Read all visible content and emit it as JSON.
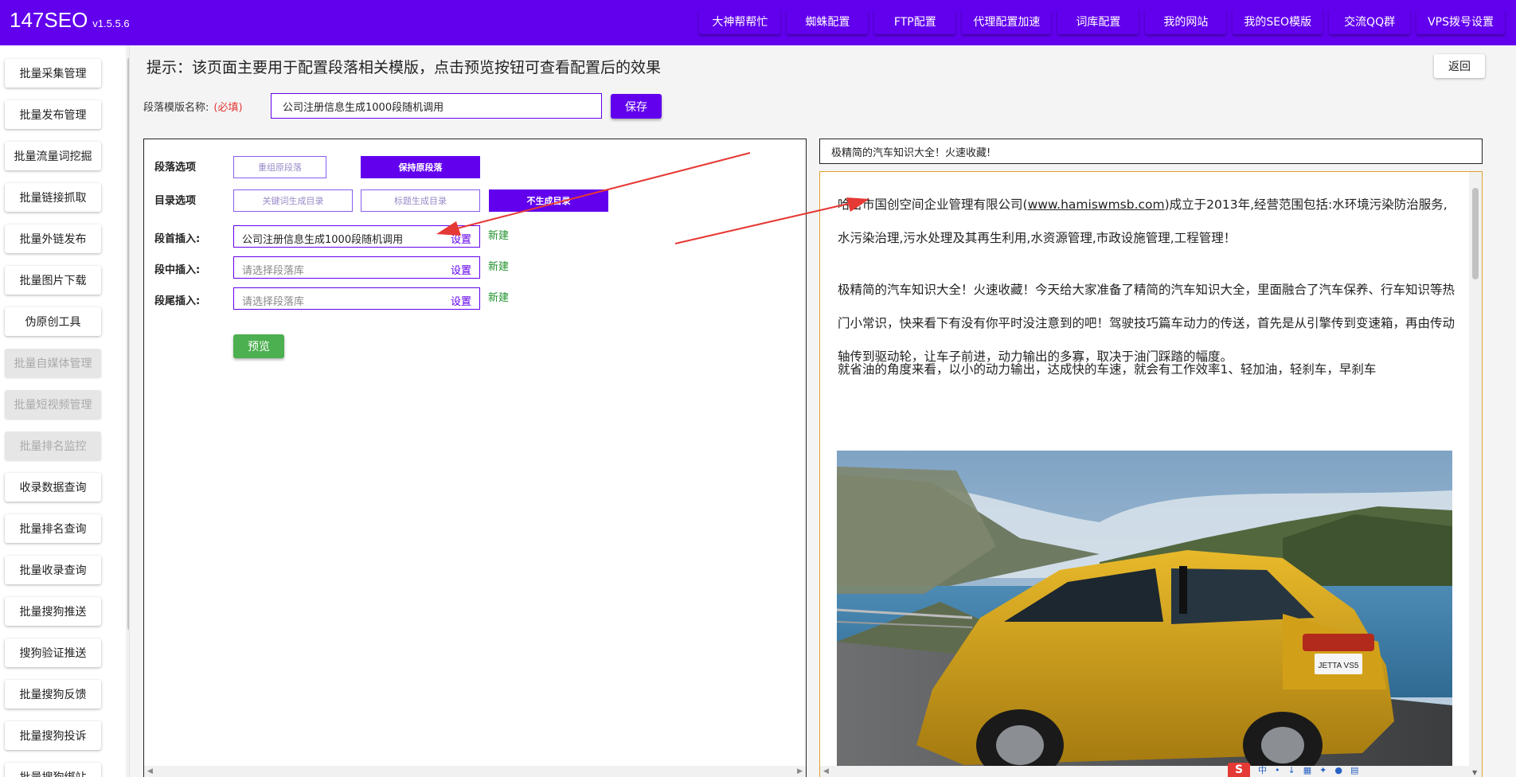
{
  "header": {
    "brand": "147SEO",
    "version": "v1.5.5.6",
    "nav": [
      "大神帮帮忙",
      "蜘蛛配置",
      "FTP配置",
      "代理配置加速",
      "词库配置",
      "我的网站",
      "我的SEO模版",
      "交流QQ群",
      "VPS拨号设置"
    ]
  },
  "sidebar": {
    "items": [
      {
        "label": "批量采集管理",
        "enabled": true
      },
      {
        "label": "批量发布管理",
        "enabled": true
      },
      {
        "label": "批量流量词挖掘",
        "enabled": true
      },
      {
        "label": "批量链接抓取",
        "enabled": true
      },
      {
        "label": "批量外链发布",
        "enabled": true
      },
      {
        "label": "批量图片下载",
        "enabled": true
      },
      {
        "label": "伪原创工具",
        "enabled": true
      },
      {
        "label": "批量自媒体管理",
        "enabled": false
      },
      {
        "label": "批量短视频管理",
        "enabled": false
      },
      {
        "label": "批量排名监控",
        "enabled": false
      },
      {
        "label": "收录数据查询",
        "enabled": true
      },
      {
        "label": "批量排名查询",
        "enabled": true
      },
      {
        "label": "批量收录查询",
        "enabled": true
      },
      {
        "label": "批量搜狗推送",
        "enabled": true
      },
      {
        "label": "搜狗验证推送",
        "enabled": true
      },
      {
        "label": "批量搜狗反馈",
        "enabled": true
      },
      {
        "label": "批量搜狗投诉",
        "enabled": true
      },
      {
        "label": "批量搜狗绑站",
        "enabled": true
      }
    ]
  },
  "main": {
    "hint": "提示：该页面主要用于配置段落相关模版，点击预览按钮可查看配置后的效果",
    "back_label": "返回",
    "template_name_label": "段落模版名称:",
    "required_mark": "(必填)",
    "template_name_value": "公司注册信息生成1000段随机调用",
    "save_label": "保存"
  },
  "config": {
    "paragraph_options_label": "段落选项",
    "paragraph_options": [
      "重组原段落",
      "保持原段落"
    ],
    "paragraph_selected": 1,
    "toc_options_label": "目录选项",
    "toc_options": [
      "关键词生成目录",
      "标题生成目录",
      "不生成目录"
    ],
    "toc_selected": 2,
    "inserts": [
      {
        "label": "段首插入:",
        "value": "公司注册信息生成1000段随机调用",
        "placeholder": "请选择段落库",
        "set_label": "设置",
        "new_label": "新建"
      },
      {
        "label": "段中插入:",
        "value": "",
        "placeholder": "请选择段落库",
        "set_label": "设置",
        "new_label": "新建"
      },
      {
        "label": "段尾插入:",
        "value": "",
        "placeholder": "请选择段落库",
        "set_label": "设置",
        "new_label": "新建"
      }
    ],
    "preview_label": "预览"
  },
  "preview": {
    "title": "极精简的汽车知识大全！火速收藏!",
    "para1_before": "哈密市国创空间企业管理有限公司(",
    "para1_link": "www.hamiswmsb.com",
    "para1_after": ")成立于2013年,经营范围包括:水环境污染防治服务,水污染治理,污水处理及其再生利用,水资源管理,市政设施管理,工程管理！",
    "para2": "极精简的汽车知识大全！火速收藏！今天给大家准备了精简的汽车知识大全，里面融合了汽车保养、行车知识等热门小常识，快来看下有没有你平时没注意到的吧！驾驶技巧篇车动力的传送，首先是从引擎传到变速箱，再由传动轴传到驱动轮，让车子前进，动力输出的多寡，取决于油门踩踏的幅度。",
    "para3": "就省油的角度来看，以小的动力输出，达成快的车速，就会有工作效率1、轻加油，轻刹车，早刹车",
    "car_badge": "JETTA VS5"
  },
  "tray": {
    "logo": "S",
    "items": [
      "中",
      "•",
      "↓",
      "▦",
      "✦",
      "●",
      "▤"
    ]
  },
  "colors": {
    "primary": "#6200ee",
    "green": "#4caf50",
    "required": "#e53935",
    "preview_border": "#e0a030",
    "arrow": "#e53935"
  }
}
